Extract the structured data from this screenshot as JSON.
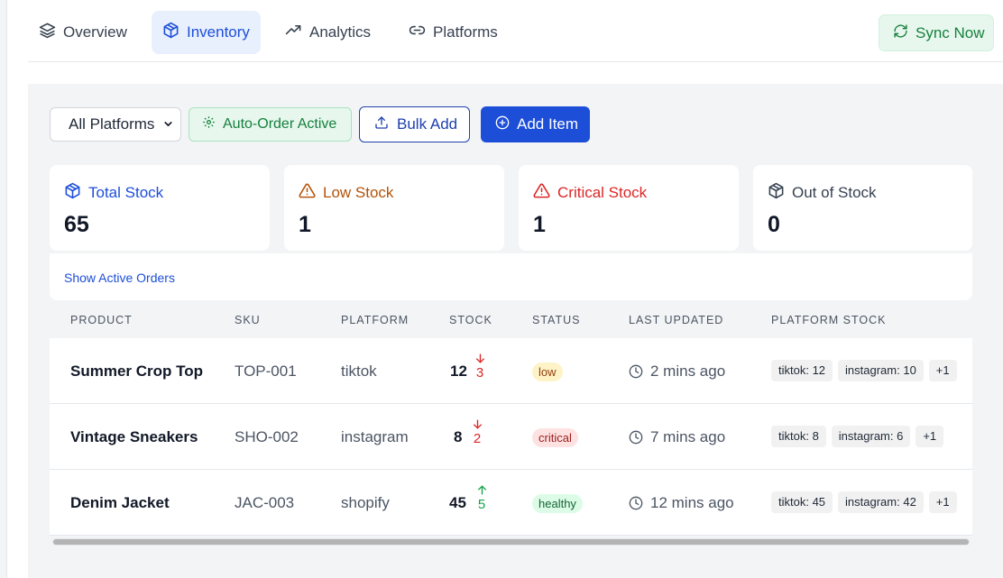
{
  "nav": {
    "tabs": [
      {
        "label": "Overview",
        "icon": "layers-icon"
      },
      {
        "label": "Inventory",
        "icon": "package-icon",
        "active": true
      },
      {
        "label": "Analytics",
        "icon": "trending-up-icon"
      },
      {
        "label": "Platforms",
        "icon": "link-icon"
      }
    ],
    "sync_label": "Sync Now"
  },
  "toolbar": {
    "platform_filter": "All Platforms",
    "auto_order_label": "Auto-Order Active",
    "bulk_add_label": "Bulk Add",
    "add_item_label": "Add Item"
  },
  "stats": {
    "total": {
      "label": "Total Stock",
      "value": "65",
      "color": "#1d4ed8"
    },
    "low": {
      "label": "Low Stock",
      "value": "1",
      "color": "#b45309"
    },
    "critical": {
      "label": "Critical Stock",
      "value": "1",
      "color": "#dc2626"
    },
    "out": {
      "label": "Out of Stock",
      "value": "0",
      "color": "#374151"
    }
  },
  "orders": {
    "link_label": "Show Active Orders"
  },
  "table": {
    "headers": [
      "PRODUCT",
      "SKU",
      "PLATFORM",
      "STOCK",
      "STATUS",
      "LAST UPDATED",
      "PLATFORM STOCK"
    ],
    "rows": [
      {
        "product": "Summer Crop Top",
        "sku": "TOP-001",
        "platform": "tiktok",
        "stock": "12",
        "change": "3",
        "direction": "down",
        "status": "low",
        "updated": "2 mins ago",
        "platform_stock": [
          "tiktok: 12",
          "instagram: 10",
          "+1"
        ]
      },
      {
        "product": "Vintage Sneakers",
        "sku": "SHO-002",
        "platform": "instagram",
        "stock": "8",
        "change": "2",
        "direction": "down",
        "status": "critical",
        "updated": "7 mins ago",
        "platform_stock": [
          "tiktok: 8",
          "instagram: 6",
          "+1"
        ]
      },
      {
        "product": "Denim Jacket",
        "sku": "JAC-003",
        "platform": "shopify",
        "stock": "45",
        "change": "5",
        "direction": "up",
        "status": "healthy",
        "updated": "12 mins ago",
        "platform_stock": [
          "tiktok: 45",
          "instagram: 42",
          "+1"
        ]
      }
    ]
  }
}
